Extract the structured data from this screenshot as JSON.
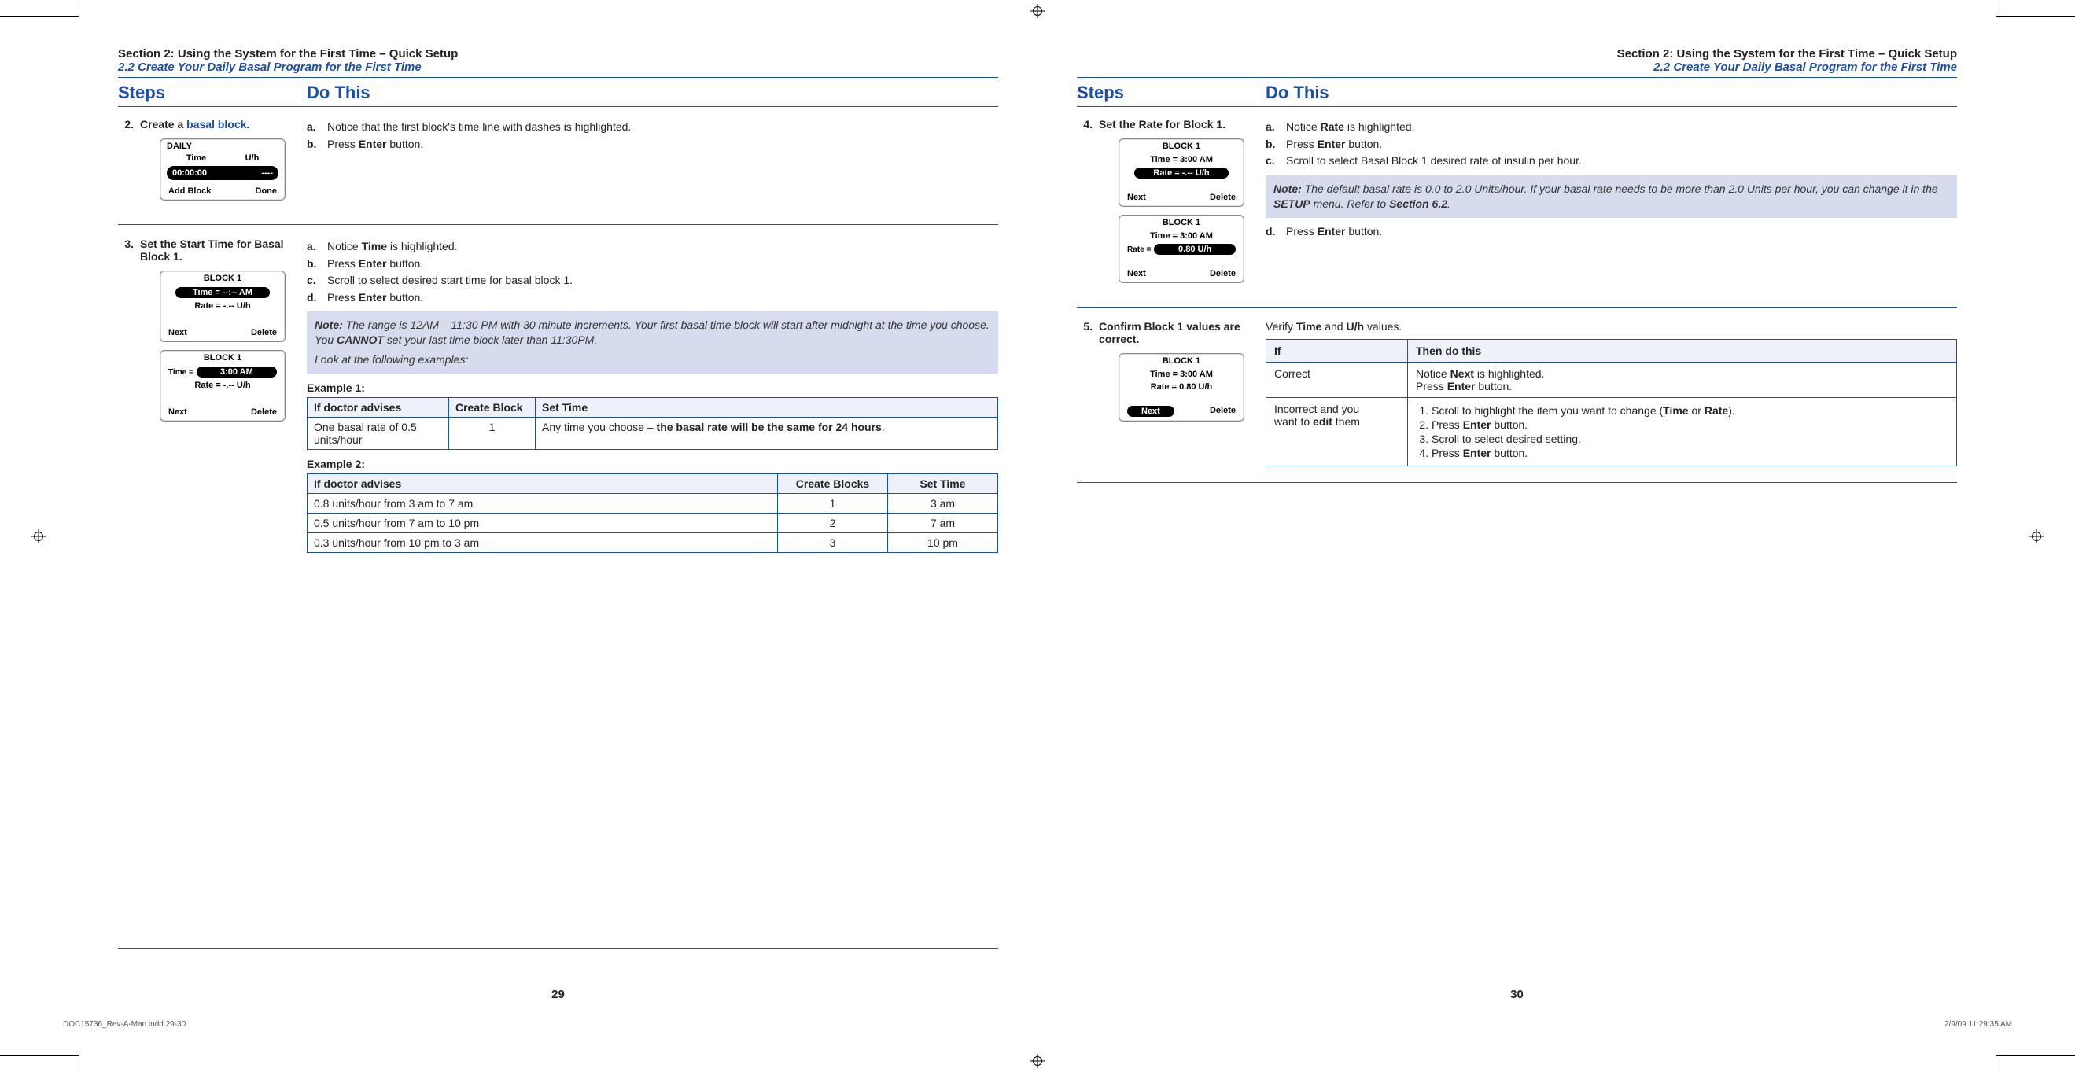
{
  "crop": {},
  "header_left": {
    "h1": "Section 2: Using the System for the First Time – Quick Setup",
    "h2": "2.2 Create Your Daily Basal Program for the First Time"
  },
  "header_right": {
    "h1": "Section 2: Using the System for the First Time – Quick Setup",
    "h2": "2.2 Create Your Daily Basal Program for the First Time"
  },
  "colhead": {
    "steps": "Steps",
    "dothis": "Do This"
  },
  "step2": {
    "num": "2.",
    "title_prefix": "Create a ",
    "title_link": "basal block",
    "title_suffix": ".",
    "a_lab": "a.",
    "a": "Notice that the first block's time line with dashes is highlighted.",
    "b_lab": "b.",
    "b_pre": "Press ",
    "b_bold": "Enter",
    "b_post": " button."
  },
  "device_daily": {
    "title": "DAILY",
    "col1": "Time",
    "col2": "U/h",
    "sel_time": "00:00:00",
    "sel_uh": "----",
    "foot_l": "Add Block",
    "foot_r": "Done"
  },
  "step3": {
    "num": "3.",
    "title": "Set the Start Time for Basal Block 1.",
    "a_lab": "a.",
    "a_pre": "Notice ",
    "a_bold": "Time",
    "a_post": " is highlighted.",
    "b_lab": "b.",
    "b_pre": "Press ",
    "b_bold": "Enter",
    "b_post": " button.",
    "c_lab": "c.",
    "c": "Scroll to select desired start time for basal block 1.",
    "d_lab": "d.",
    "d_pre": "Press ",
    "d_bold": "Enter",
    "d_post": " button.",
    "note_label": "Note:",
    "note_body_1": " The range is 12AM – 11:30 PM with 30 minute increments. Your first basal time block will start after midnight at the time you choose. You ",
    "note_bold": "CANNOT",
    "note_body_2": " set your last time block later than 11:30PM.",
    "note_line2": "Look at the following examples:",
    "ex1_label": "Example 1:",
    "ex1_h1": "If doctor advises",
    "ex1_h2": "Create Block",
    "ex1_h3": "Set Time",
    "ex1_r1c1": "One basal rate of 0.5 units/hour",
    "ex1_r1c2": "1",
    "ex1_r1c3_pre": "Any time you choose – ",
    "ex1_r1c3_bold": "the basal rate will be the same for 24 hours",
    "ex1_r1c3_post": ".",
    "ex2_label": "Example 2:",
    "ex2_h1": "If doctor advises",
    "ex2_h2": "Create Blocks",
    "ex2_h3": "Set Time",
    "ex2": [
      {
        "c1": "0.8 units/hour from 3 am to 7 am",
        "c2": "1",
        "c3": "3 am"
      },
      {
        "c1": "0.5 units/hour from 7 am to 10 pm",
        "c2": "2",
        "c3": "7 am"
      },
      {
        "c1": "0.3 units/hour from 10 pm to 3 am",
        "c2": "3",
        "c3": "10 pm"
      }
    ]
  },
  "device_block1a": {
    "title": "BLOCK 1",
    "sel": "Time = --:--  AM",
    "rate": "Rate = -.-- U/h",
    "foot_l": "Next",
    "foot_r": "Delete"
  },
  "device_block1b": {
    "title": "BLOCK 1",
    "time_label": "Time =",
    "sel": "3:00  AM",
    "rate": "Rate = -.-- U/h",
    "foot_l": "Next",
    "foot_r": "Delete"
  },
  "step4": {
    "num": "4.",
    "title": "Set the Rate for Block 1.",
    "a_lab": "a.",
    "a_pre": "Notice ",
    "a_bold": "Rate",
    "a_post": " is highlighted.",
    "b_lab": "b.",
    "b_pre": "Press ",
    "b_bold": "Enter",
    "b_post": " button.",
    "c_lab": "c.",
    "c": "Scroll to select Basal Block 1 desired rate of insulin per hour.",
    "note_label": "Note:",
    "note_body_1": " The default basal rate is 0.0 to 2.0 Units/hour. If your basal rate needs to be more than 2.0 Units per hour, you can change it in the ",
    "note_bold1": "SETUP",
    "note_body_2": " menu. Refer to ",
    "note_bold2": "Section 6.2",
    "note_body_3": ".",
    "d_lab": "d.",
    "d_pre": "Press ",
    "d_bold": "Enter",
    "d_post": " button."
  },
  "device_block1c": {
    "title": "BLOCK 1",
    "time": "Time = 3:00 AM",
    "sel": "Rate = -.-- U/h",
    "foot_l": "Next",
    "foot_r": "Delete"
  },
  "device_block1d": {
    "title": "BLOCK 1",
    "time": "Time = 3:00 AM",
    "rate_label": "Rate =",
    "sel": "0.80  U/h",
    "foot_l": "Next",
    "foot_r": "Delete"
  },
  "step5": {
    "num": "5.",
    "title": "Confirm Block 1 values are correct.",
    "verify_pre": "Verify ",
    "verify_b1": "Time",
    "verify_mid": " and ",
    "verify_b2": "U/h",
    "verify_post": " values.",
    "th1": "If",
    "th2": "Then do this",
    "r1c1": "Correct",
    "r1c2_l1_pre": "Notice ",
    "r1c2_l1_b": "Next",
    "r1c2_l1_post": " is highlighted.",
    "r1c2_l2_pre": "Press ",
    "r1c2_l2_b": "Enter",
    "r1c2_l2_post": " button.",
    "r2c1_l1": "Incorrect and you",
    "r2c1_l2_pre": "want to ",
    "r2c1_l2_b": "edit",
    "r2c1_l2_post": " them",
    "r2_li1_pre": "Scroll to highlight the item you want to change (",
    "r2_li1_b1": "Time",
    "r2_li1_mid": " or ",
    "r2_li1_b2": "Rate",
    "r2_li1_post": ").",
    "r2_li2_pre": "Press ",
    "r2_li2_b": "Enter",
    "r2_li2_post": " button.",
    "r2_li3": "Scroll to select desired setting.",
    "r2_li4_pre": "Press ",
    "r2_li4_b": "Enter",
    "r2_li4_post": " button."
  },
  "device_block1e": {
    "title": "BLOCK 1",
    "time": "Time = 3:00 AM",
    "rate": "Rate = 0.80 U/h",
    "sel": "Next",
    "foot_r": "Delete"
  },
  "page_left_num": "29",
  "page_right_num": "30",
  "slug_left": "DOC15736_Rev-A-Man.indd   29-30",
  "slug_right": "2/9/09   11:29:35 AM"
}
